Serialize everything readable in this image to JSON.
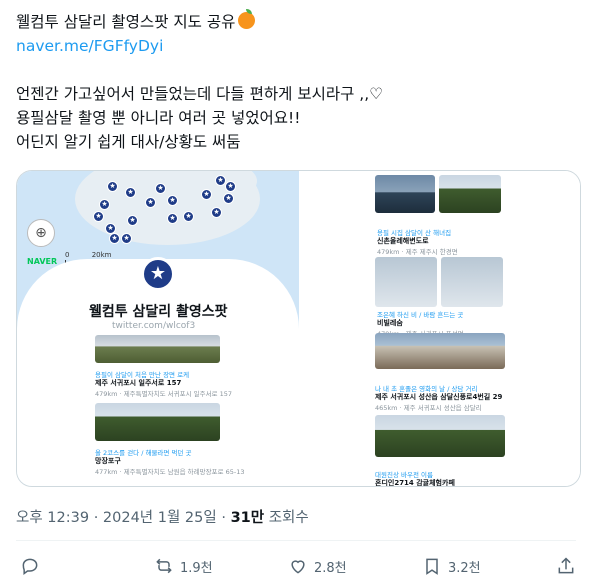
{
  "tweet": {
    "title_line": "웰컴투 삼달리 촬영스팟 지도 공유",
    "title_emoji": "orange-emoji",
    "link": "naver.me/FGFfyDyi",
    "line3": "언젠간 가고싶어서 만들었는데 다들 편하게 보시라구 ,,♡",
    "line4": "용필삼달 촬영 뿐 아니라 여러 곳 넣었어요!!",
    "line5": "어딘지 알기 쉽게 대사/상황도 써둠"
  },
  "media": {
    "naver_label": "NAVER",
    "scale_label_0": "0",
    "scale_label_20": "20km",
    "card_title": "웰컴투 삼달리 촬영스팟",
    "card_subtitle": "twitter.com/wlcof3",
    "left_items": [
      {
        "tag": "용필이 삼달이 처음 만난 장면 로케",
        "name": "제주 서귀포시 일주서로 157",
        "sub": "479km · 제주특별자치도 서귀포시 일주서로 157"
      },
      {
        "tag": "올 2코스를 걷다 / 해물라면 먹던 곳",
        "name": "망장포구",
        "sub": "477km · 제주특별자치도 남원읍 하례망장포로 65-13"
      }
    ],
    "right_items": [
      {
        "tag": "용필 시집 삼달이 산 해녀집",
        "name": "신촌올레해변도로",
        "sub": "479km · 제주 제주시 한경면"
      },
      {
        "tag": "조은혜 하신 비 / 바람 흔드는 곳",
        "name": "비빌레숨",
        "sub": "479km · 제주 서귀포시 표선면"
      },
      {
        "tag": "나 내 초 혼졸은 영화의 날 / 상담 거리",
        "name": "제주 서귀포시 성산읍 삼달신풍로4번길 29",
        "sub": "465km · 제주 서귀포시 성산읍 삼달리"
      },
      {
        "tag": "대원진상 바우전 이름",
        "name": "혼디인2714 감귤체험카페",
        "sub": ""
      }
    ]
  },
  "meta": {
    "time": "오후 12:39",
    "dot": "·",
    "date": "2024년 1월 25일",
    "views_count": "31만",
    "views_label": "조회수"
  },
  "actions": {
    "reply_count": "",
    "retweet_count": "1.9천",
    "like_count": "2.8천",
    "bookmark_count": "3.2천"
  },
  "colors": {
    "link": "#1d9bf0",
    "pin": "#1f3c88",
    "muted": "#536471"
  }
}
